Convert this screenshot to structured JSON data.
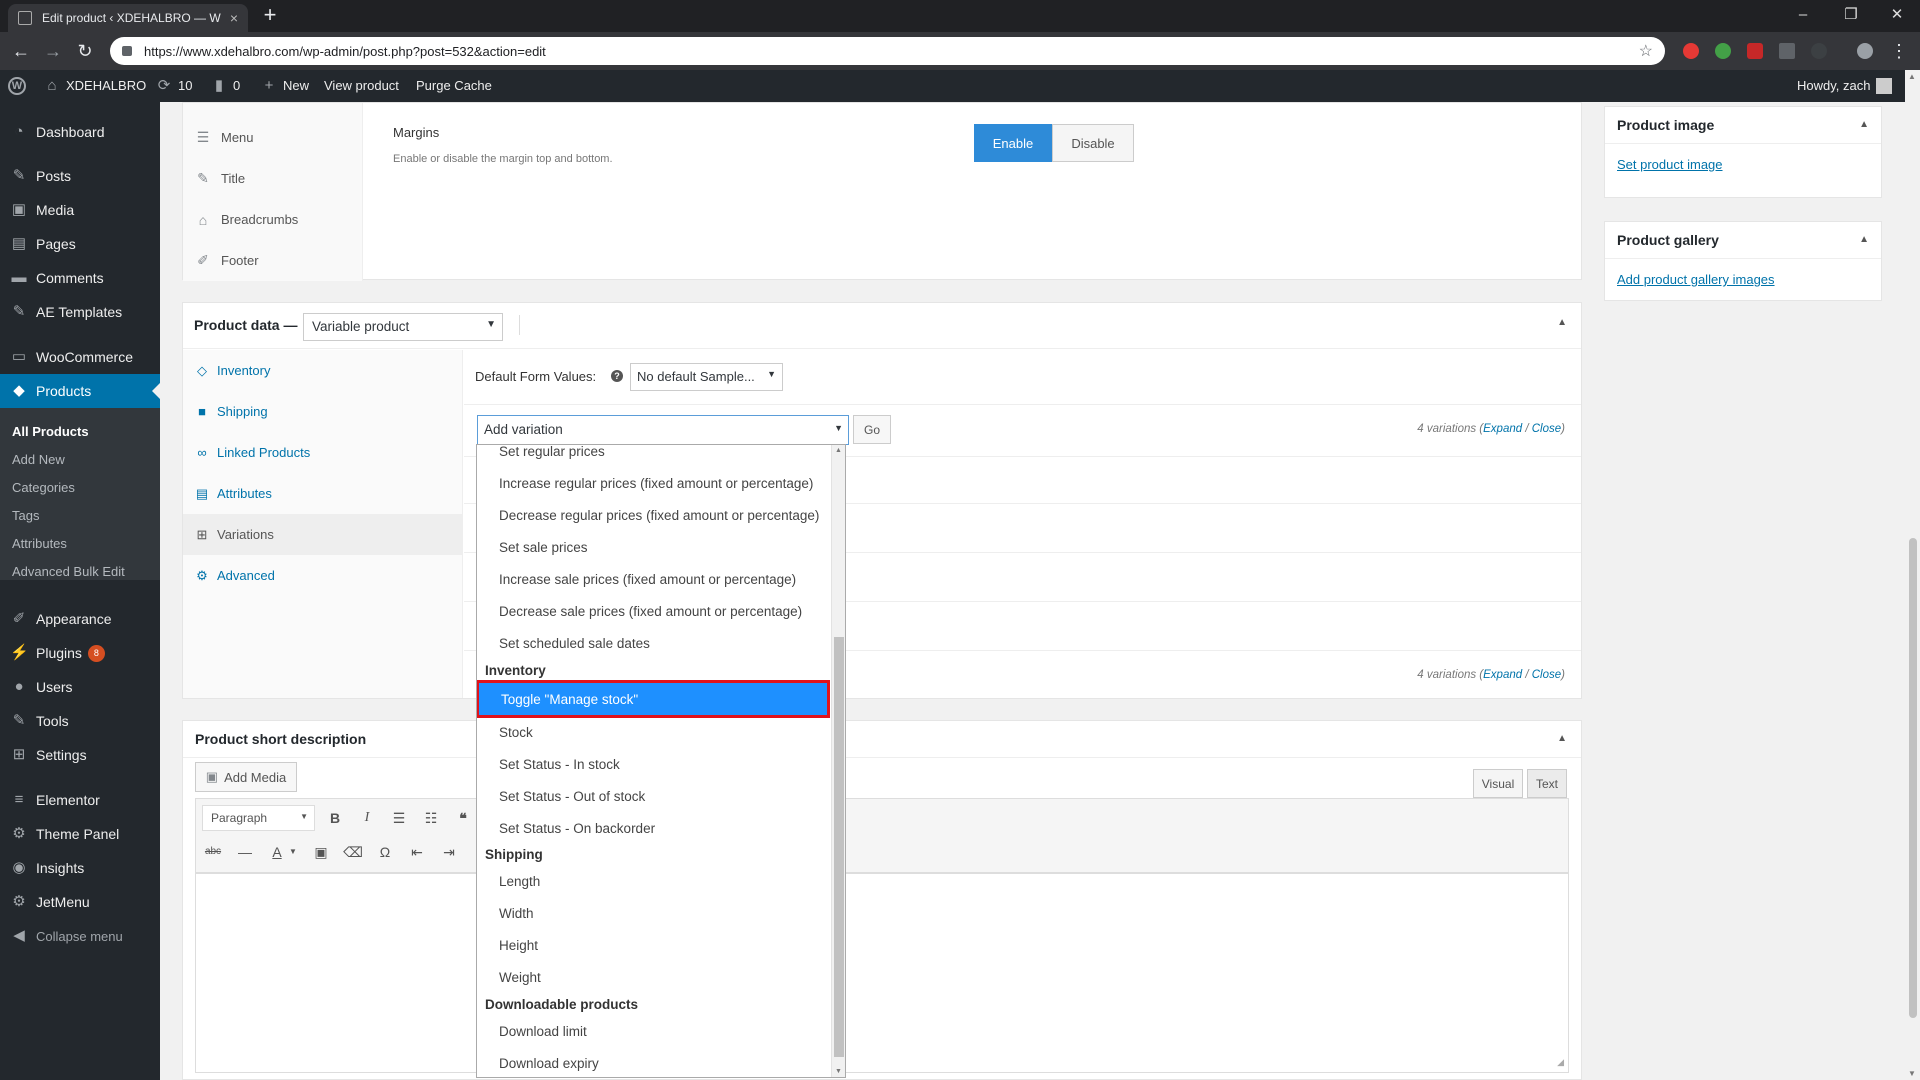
{
  "browser": {
    "tab_title": "Edit product ‹ XDEHALBRO — W",
    "tab_close": "×",
    "new_tab": "+",
    "url": "https://www.xdehalbro.com/wp-admin/post.php?post=532&action=edit",
    "window_controls": {
      "minimize": "–",
      "restore": "❐",
      "close": "✕"
    }
  },
  "adminbar": {
    "site_name": "XDEHALBRO",
    "updates_count": "10",
    "comments_count": "0",
    "new_label": "New",
    "view_product": "View product",
    "purge_cache": "Purge Cache",
    "howdy": "Howdy, zach"
  },
  "sidebar": {
    "items": [
      {
        "label": "Dashboard",
        "icon": "dashboard-icon"
      },
      {
        "label": "Posts",
        "icon": "pin-icon"
      },
      {
        "label": "Media",
        "icon": "media-icon"
      },
      {
        "label": "Pages",
        "icon": "page-icon"
      },
      {
        "label": "Comments",
        "icon": "comment-icon"
      },
      {
        "label": "AE Templates",
        "icon": "pin-icon"
      },
      {
        "label": "WooCommerce",
        "icon": "woo-icon"
      },
      {
        "label": "Products",
        "icon": "box-icon"
      },
      {
        "label": "Appearance",
        "icon": "brush-icon"
      },
      {
        "label": "Plugins",
        "icon": "plugin-icon",
        "badge": "8"
      },
      {
        "label": "Users",
        "icon": "user-icon"
      },
      {
        "label": "Tools",
        "icon": "wrench-icon"
      },
      {
        "label": "Settings",
        "icon": "settings-icon"
      },
      {
        "label": "Elementor",
        "icon": "elementor-icon"
      },
      {
        "label": "Theme Panel",
        "icon": "gear-icon"
      },
      {
        "label": "Insights",
        "icon": "insights-icon"
      },
      {
        "label": "JetMenu",
        "icon": "gear-icon"
      },
      {
        "label": "Collapse menu",
        "icon": "collapse-icon"
      }
    ],
    "submenu": [
      "All Products",
      "Add New",
      "Categories",
      "Tags",
      "Attributes",
      "Advanced Bulk Edit"
    ]
  },
  "settings_box": {
    "tabs": [
      "Menu",
      "Title",
      "Breadcrumbs",
      "Footer"
    ],
    "margins_title": "Margins",
    "margins_desc": "Enable or disable the margin top and bottom.",
    "enable": "Enable",
    "disable": "Disable"
  },
  "product_data": {
    "label": "Product data —",
    "type_value": "Variable product",
    "tabs": [
      "Inventory",
      "Shipping",
      "Linked Products",
      "Attributes",
      "Variations",
      "Advanced"
    ],
    "default_form_values_label": "Default Form Values:",
    "default_select": "No default Sample...",
    "add_variation": "Add variation",
    "go": "Go",
    "variations_count": "4 variations",
    "expand": "Expand",
    "close": "Close",
    "help_icon": "?"
  },
  "dropdown": {
    "options_top": [
      "Set regular prices",
      "Increase regular prices (fixed amount or percentage)",
      "Decrease regular prices (fixed amount or percentage)",
      "Set sale prices",
      "Increase sale prices (fixed amount or percentage)",
      "Decrease sale prices (fixed amount or percentage)",
      "Set scheduled sale dates"
    ],
    "group_inventory": "Inventory",
    "inventory_options": [
      "Toggle \"Manage stock\"",
      "Stock",
      "Set Status - In stock",
      "Set Status - Out of stock",
      "Set Status - On backorder"
    ],
    "group_shipping": "Shipping",
    "shipping_options": [
      "Length",
      "Width",
      "Height",
      "Weight"
    ],
    "group_downloadable": "Downloadable products",
    "downloadable_options": [
      "Download limit",
      "Download expiry"
    ]
  },
  "short_desc": {
    "title": "Product short description",
    "add_media": "Add Media",
    "paragraph": "Paragraph",
    "visual": "Visual",
    "text": "Text"
  },
  "product_image": {
    "title": "Product image",
    "link": "Set product image"
  },
  "product_gallery": {
    "title": "Product gallery",
    "link": "Add product gallery images"
  }
}
